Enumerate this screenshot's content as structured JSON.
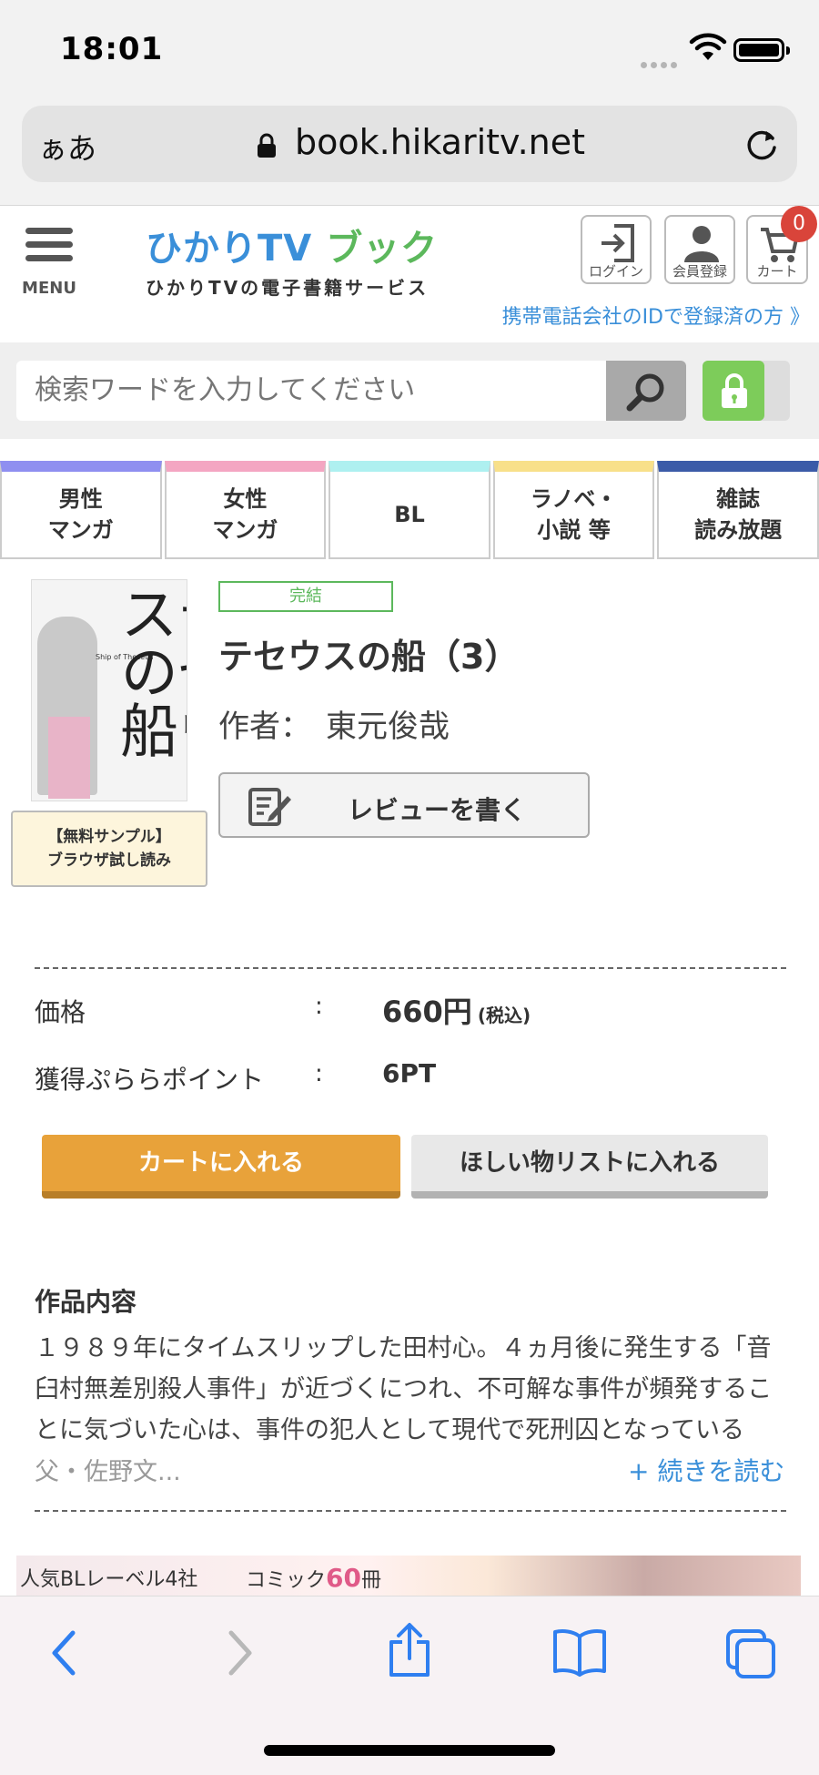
{
  "status": {
    "time": "18:01"
  },
  "browser": {
    "aa_label": "ぁあ",
    "url": "book.hikaritv.net"
  },
  "header": {
    "menu_label": "MENU",
    "logo_main": "ひかりTV",
    "logo_book": "ブック",
    "logo_sub": "ひかりTVの電子書籍サービス",
    "login_label": "ログイン",
    "register_label": "会員登録",
    "cart_label": "カート",
    "cart_count": "0",
    "carrier_link": "携帯電話会社のIDで登録済の方 》"
  },
  "search": {
    "placeholder": "検索ワードを入力してください"
  },
  "tabs": [
    {
      "label": "男性\nマンガ",
      "color": "#8f8ff0"
    },
    {
      "label": "女性\nマンガ",
      "color": "#f4a6c2"
    },
    {
      "label": "BL",
      "color": "#aef0f0"
    },
    {
      "label": "ラノベ・\n小説 等",
      "color": "#f8e08a"
    },
    {
      "label": "雑誌\n読み放題",
      "color": "#3b5ba8"
    }
  ],
  "product": {
    "cover_title": "テセウスの船",
    "sample_label_1": "【無料サンプル】",
    "sample_label_2": "ブラウザ試し読み",
    "status": "完結",
    "title": "テセウスの船（3）",
    "author_label": "作者：",
    "author": "東元俊哉",
    "review_label": "レビューを書く"
  },
  "pricing": {
    "price_label": "価格",
    "price_colon": ":",
    "price": "660円",
    "price_tax": "(税込)",
    "points_label": "獲得ぷららポイント",
    "points_colon": ":",
    "points": "6PT"
  },
  "actions": {
    "cart": "カートに入れる",
    "wishlist": "ほしい物リストに入れる"
  },
  "description": {
    "heading": "作品内容",
    "text": "１９８９年にタイムスリップした田村心。４ヵ月後に発生する「音臼村無差別殺人事件」が近づくにつれ、不可解な事件が頻発することに気づいた心は、事件の犯人として現代で死刑囚となっている",
    "fade_text": "父・佐野文...",
    "read_more": "+ 続きを読む"
  },
  "banner": {
    "text1": "人気BLレーベル4社",
    "text2_prefix": "コミック",
    "text2_num": "60",
    "text2_suffix": "冊"
  },
  "colors": {
    "accent_blue": "#3a8fd9",
    "cart_orange": "#e8a23a",
    "complete_green": "#5cb85c",
    "badge_red": "#d9443a"
  }
}
